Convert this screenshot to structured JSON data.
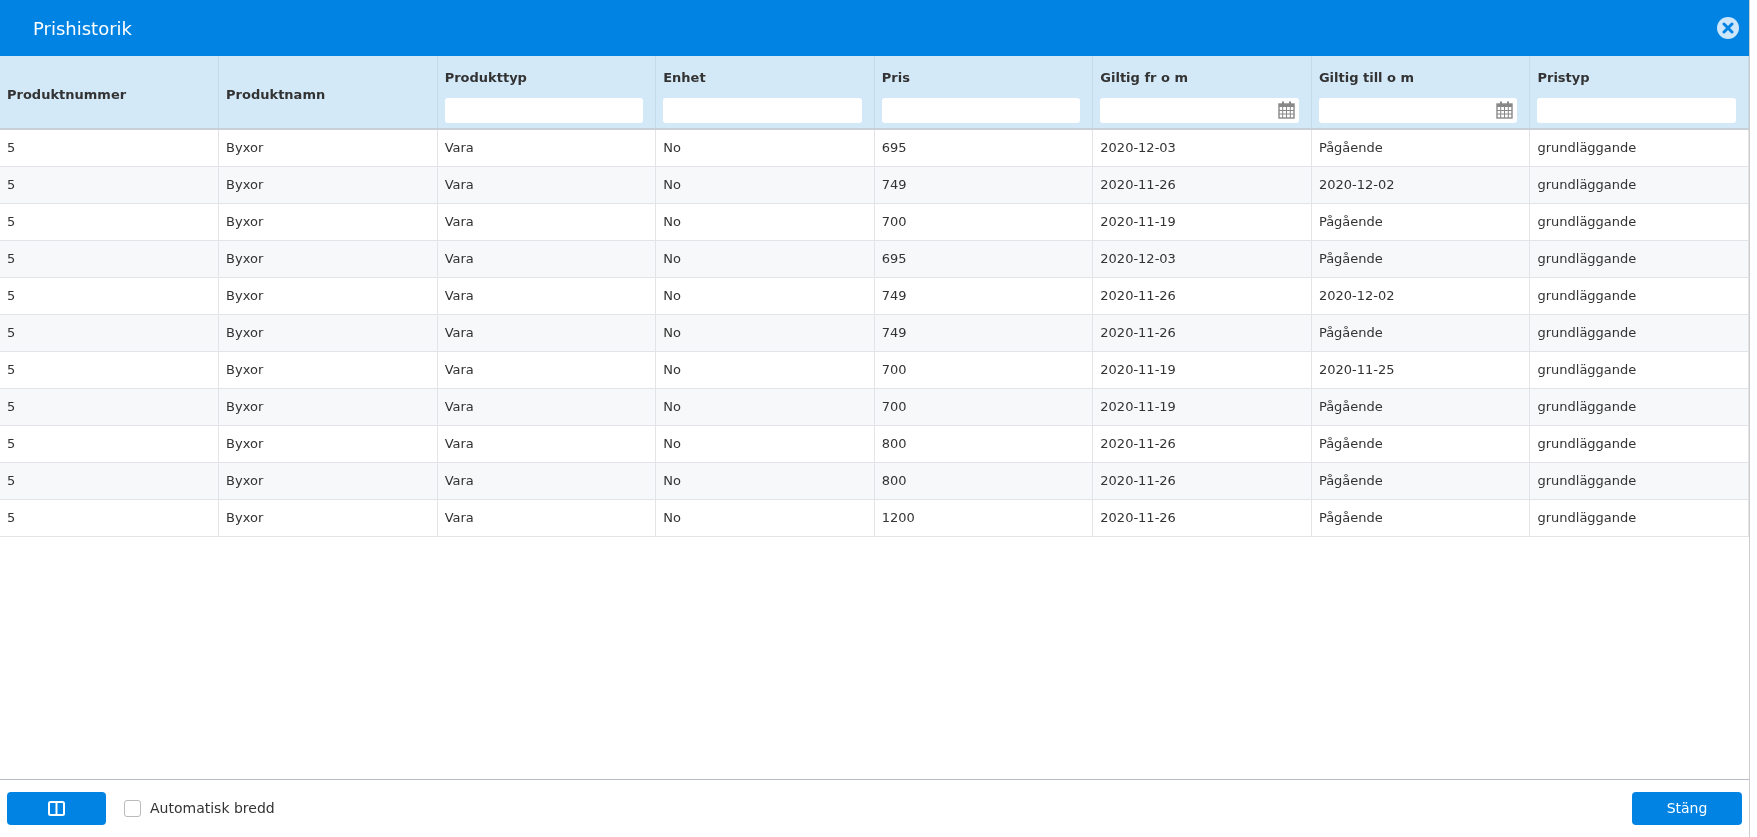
{
  "window": {
    "title": "Prishistorik"
  },
  "table": {
    "columns": [
      {
        "label": "Produktnummer",
        "kind": "plain"
      },
      {
        "label": "Produktnamn",
        "kind": "plain"
      },
      {
        "label": "Produkttyp",
        "kind": "text"
      },
      {
        "label": "Enhet",
        "kind": "text"
      },
      {
        "label": "Pris",
        "kind": "text"
      },
      {
        "label": "Giltig fr o m",
        "kind": "date"
      },
      {
        "label": "Giltig till o m",
        "kind": "date"
      },
      {
        "label": "Pristyp",
        "kind": "text"
      }
    ],
    "rows": [
      [
        "5",
        "Byxor",
        "Vara",
        "No",
        "695",
        "2020-12-03",
        "Pågående",
        "grundläggande"
      ],
      [
        "5",
        "Byxor",
        "Vara",
        "No",
        "749",
        "2020-11-26",
        "2020-12-02",
        "grundläggande"
      ],
      [
        "5",
        "Byxor",
        "Vara",
        "No",
        "700",
        "2020-11-19",
        "Pågående",
        "grundläggande"
      ],
      [
        "5",
        "Byxor",
        "Vara",
        "No",
        "695",
        "2020-12-03",
        "Pågående",
        "grundläggande"
      ],
      [
        "5",
        "Byxor",
        "Vara",
        "No",
        "749",
        "2020-11-26",
        "2020-12-02",
        "grundläggande"
      ],
      [
        "5",
        "Byxor",
        "Vara",
        "No",
        "749",
        "2020-11-26",
        "Pågående",
        "grundläggande"
      ],
      [
        "5",
        "Byxor",
        "Vara",
        "No",
        "700",
        "2020-11-19",
        "2020-11-25",
        "grundläggande"
      ],
      [
        "5",
        "Byxor",
        "Vara",
        "No",
        "700",
        "2020-11-19",
        "Pågående",
        "grundläggande"
      ],
      [
        "5",
        "Byxor",
        "Vara",
        "No",
        "800",
        "2020-11-26",
        "Pågående",
        "grundläggande"
      ],
      [
        "5",
        "Byxor",
        "Vara",
        "No",
        "800",
        "2020-11-26",
        "Pågående",
        "grundläggande"
      ],
      [
        "5",
        "Byxor",
        "Vara",
        "No",
        "1200",
        "2020-11-26",
        "Pågående",
        "grundläggande"
      ]
    ]
  },
  "footer": {
    "auto_width": {
      "label": "Automatisk bredd",
      "checked": false
    },
    "close_button": "Stäng"
  }
}
